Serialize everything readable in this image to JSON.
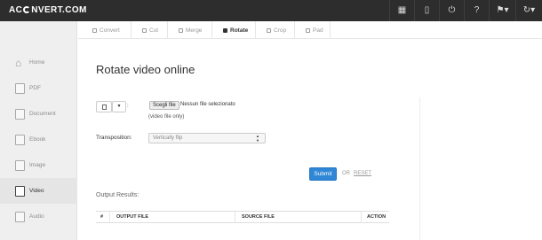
{
  "app": {
    "logo_left": "AC",
    "logo_right": "NVERT.COM"
  },
  "topbar": {
    "icons": [
      "grid-icon",
      "tablet-icon",
      "power-icon",
      "help-icon",
      "language-icon",
      "refresh-icon"
    ]
  },
  "sidebar": {
    "items": [
      {
        "label": "Home",
        "icon": "home-icon"
      },
      {
        "label": "PDF",
        "icon": "pdf-icon"
      },
      {
        "label": "Document",
        "icon": "document-icon"
      },
      {
        "label": "Ebook",
        "icon": "ebook-icon"
      },
      {
        "label": "Image",
        "icon": "image-icon"
      },
      {
        "label": "Video",
        "icon": "video-icon",
        "active": true
      },
      {
        "label": "Audio",
        "icon": "audio-icon"
      }
    ]
  },
  "tabs": [
    {
      "label": "Convert",
      "checked": false
    },
    {
      "label": "Cut",
      "checked": false
    },
    {
      "label": "Merge",
      "checked": false
    },
    {
      "label": "Rotate",
      "checked": true
    },
    {
      "label": "Crop",
      "checked": false
    },
    {
      "label": "Pad",
      "checked": false
    }
  ],
  "main": {
    "title": "Rotate video online",
    "file": {
      "choose_label": "Scegli file",
      "no_file_text": "Nessun file selezionato",
      "hint": "(video file only)"
    },
    "transposition": {
      "label": "Transposition:",
      "value": "Vertically flip"
    },
    "submit_label": "Submit",
    "or_text": "OR",
    "reset_label": "RESET",
    "output_label": "Output Results:",
    "table_headers": [
      "#",
      "OUTPUT FILE",
      "SOURCE FILE",
      "ACTION"
    ]
  },
  "colors": {
    "topbar": "#2d2d2d",
    "accent": "#2f87d6",
    "sidebar": "#efefef"
  }
}
